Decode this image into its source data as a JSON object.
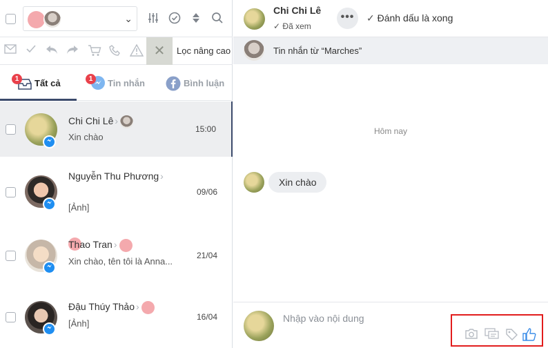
{
  "toolbar": {
    "advanced_filter_label": "Lọc nâng cao"
  },
  "tabs": [
    {
      "label": "Tất cả",
      "badge": "1",
      "active": true
    },
    {
      "label": "Tin nhắn",
      "badge": "1",
      "active": false
    },
    {
      "label": "Bình luận",
      "badge": "",
      "active": false
    }
  ],
  "conversations": [
    {
      "name": "Chi Chi Lê",
      "snippet": "Xin chào",
      "time": "15:00",
      "selected": true
    },
    {
      "name": "Nguyễn Thu Phương",
      "snippet": "[Ảnh]",
      "time": "09/06",
      "selected": false
    },
    {
      "name": "Thao Tran",
      "snippet": "Xin chào, tên tôi là Anna...",
      "time": "21/04",
      "selected": false
    },
    {
      "name": "Đậu Thúy Thảo",
      "snippet": "[Ảnh]",
      "time": "16/04",
      "selected": false
    }
  ],
  "chat": {
    "title": "Chi Chi Lê",
    "seen_label": "Đã xem",
    "more_label": "•••",
    "mark_done_label": "Đánh dấu là xong",
    "source_label": "Tin nhắn từ  “Marches”",
    "day_separator": "Hôm nay",
    "messages": [
      {
        "text": "Xin chào",
        "direction": "in"
      }
    ],
    "composer_placeholder": "Nhập vào nội dung"
  },
  "icons": {
    "toolbar1": [
      "sliders-icon",
      "check-circle-icon",
      "sort-icon",
      "search-icon"
    ],
    "toolbar2": [
      "mail-icon",
      "check-icon",
      "reply-icon",
      "forward-icon",
      "cart-icon",
      "phone-icon",
      "warning-icon",
      "close-icon"
    ],
    "composer": [
      "camera-icon",
      "quick-reply-icon",
      "tag-icon",
      "like-icon"
    ]
  },
  "colors": {
    "accent": "#3b4a6b",
    "badge": "#e9414b",
    "messenger": "#1f8ef1",
    "highlight_box": "#e21c1c",
    "like": "#3d8ee8"
  }
}
